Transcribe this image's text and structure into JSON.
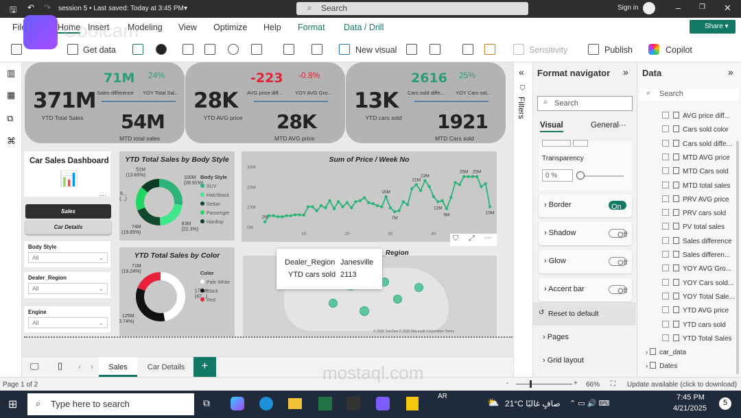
{
  "window": {
    "title": "session 5 • Last saved: Today at 3:45 PM",
    "search": "Search",
    "sign_in": "Sign in"
  },
  "menu": [
    "File",
    "Home",
    "Insert",
    "Modeling",
    "View",
    "Optimize",
    "Help",
    "Format",
    "Data / Drill"
  ],
  "share": "Share",
  "ribbon": {
    "get_data": "Get data",
    "new_visual": "New visual",
    "sensitivity": "Sensitivity",
    "publish": "Publish",
    "copilot": "Copilot"
  },
  "watermarks": {
    "coolcam": "Coolcam",
    "mostaql": "mostaql.com"
  },
  "kpis": [
    {
      "main": "371M",
      "main_label": "YTD Total Sales",
      "a": "71M",
      "a_label": "Sales difference",
      "b": "24%",
      "b_label": "YOY Total Sal...",
      "mtd": "54M",
      "mtd_label": "MTD total sales",
      "a_color": "#2a9d72"
    },
    {
      "main": "28K",
      "main_label": "YTD AVG price",
      "a": "-223",
      "a_label": "AVG price diff...",
      "b": "-0.8%",
      "b_label": "YOY AVG Gro...",
      "mtd": "28K",
      "mtd_label": "MTD AVG price",
      "a_color": "#e02238"
    },
    {
      "main": "13K",
      "main_label": "YTD cars sold",
      "a": "2616",
      "a_label": "Cars sold diffe...",
      "b": "25%",
      "b_label": "YOY Cars sol...",
      "mtd": "1921",
      "mtd_label": "MTD Cars sold",
      "a_color": "#2a9d72"
    }
  ],
  "left": {
    "title": "Car Sales Dashboard",
    "btn_sales": "Sales",
    "btn_details": "Car Details",
    "slicers": [
      {
        "label": "Body Style",
        "value": "All"
      },
      {
        "label": "Dealer_Region",
        "value": "All"
      },
      {
        "label": "Engine",
        "value": "All"
      }
    ]
  },
  "chart_data": [
    {
      "type": "pie",
      "title": "YTD Total Sales by Body Style",
      "legend_title": "Body Style",
      "legend": "right",
      "slices": [
        {
          "name": "SUV",
          "value": 100,
          "label": "100M",
          "pct": "(26.91%)",
          "color": "#2db37a"
        },
        {
          "name": "Hatchback",
          "value": 83,
          "label": "83M",
          "pct": "(22.3%)",
          "color": "#3ee88a"
        },
        {
          "name": "Sedan",
          "value": 74,
          "label": "74M",
          "pct": "(19.85%)",
          "color": "#11482e"
        },
        {
          "name": "Passenger",
          "value": 63,
          "label": "6...",
          "pct": "(...)",
          "color": "#1fd660"
        },
        {
          "name": "Hardtop",
          "value": 51,
          "label": "51M",
          "pct": "(13.65%)",
          "color": "#0d3a24"
        }
      ]
    },
    {
      "type": "line",
      "title": "Sum of Price / Week No",
      "ylim": [
        0,
        30
      ],
      "yticks": [
        "0M",
        "10M",
        "20M",
        "30M"
      ],
      "xticks": [
        10,
        20,
        30,
        40
      ],
      "unit": "M",
      "x_start": 1,
      "values": [
        2.5,
        5.5,
        5.5,
        5,
        5,
        5.5,
        5.5,
        6,
        6,
        5.8,
        10,
        10,
        8,
        10.5,
        9.5,
        13,
        9,
        12.5,
        10,
        12,
        9.5,
        12.5,
        13,
        14.5,
        12,
        11.5,
        10.5,
        10,
        15,
        9.5,
        7.5,
        8,
        12.5,
        11,
        19,
        21,
        18,
        23,
        20,
        15,
        12.5,
        13,
        9,
        14.5,
        22,
        21,
        25,
        25,
        25,
        25,
        20,
        21.5,
        10
      ],
      "point_labels": [
        {
          "week": 1,
          "text": "2M"
        },
        {
          "week": 29,
          "text": "15M"
        },
        {
          "week": 31,
          "text": "7M"
        },
        {
          "week": 36,
          "text": "21M"
        },
        {
          "week": 38,
          "text": "23M"
        },
        {
          "week": 41,
          "text": "12M"
        },
        {
          "week": 43,
          "text": "9M"
        },
        {
          "week": 47,
          "text": "25M"
        },
        {
          "week": 50,
          "text": "25M"
        },
        {
          "week": 53,
          "text": "10M"
        }
      ],
      "color": "#2db37a"
    },
    {
      "type": "pie",
      "title": "YTD Total Sales by Color",
      "legend_title": "Color",
      "legend": "right",
      "slices": [
        {
          "name": "Pale White",
          "value": 175,
          "label": "175M",
          "pct": "(47...)",
          "color": "#ffffff"
        },
        {
          "name": "Black",
          "value": 125,
          "label": "125M",
          "pct": "(33.74%)",
          "color": "#111111"
        },
        {
          "name": "Red",
          "value": 71,
          "label": "71M",
          "pct": "(19.24%)",
          "color": "#e8203a"
        }
      ]
    }
  ],
  "map": {
    "title": "ler_Region",
    "tooltip": {
      "k1": "Dealer_Region",
      "v1": "Janesville",
      "k2": "YTD cars sold",
      "v2": "2113"
    },
    "attribution": "© 2025 TomTom © 2025 Microsoft Corporation  Terms"
  },
  "filters_label": "Filters",
  "format": {
    "title": "Format navigator",
    "search": "Search",
    "tab_visual": "Visual",
    "tab_general": "General",
    "transparency": "Transparency",
    "transparency_value": "0 %",
    "transparency_pct": 0,
    "cards": [
      {
        "label": "Border",
        "state": "On",
        "on": true
      },
      {
        "label": "Shadow",
        "state": "Off",
        "on": false
      },
      {
        "label": "Glow",
        "state": "Off",
        "on": false
      },
      {
        "label": "Accent bar",
        "state": "Off",
        "on": false
      }
    ],
    "reset": "Reset to default",
    "pages": "Pages",
    "grid": "Grid layout"
  },
  "data": {
    "title": "Data",
    "search": "Search",
    "fields": [
      "AVG price diff...",
      "Cars sold color",
      "Cars sold diffe...",
      "MTD AVG price",
      "MTD Cars sold",
      "MTD total sales",
      "PRV AVG price",
      "PRV cars sold",
      "PV total sales",
      "Sales difference",
      "Sales differen...",
      "YOY AVG Gro...",
      "YOY Cars sold...",
      "YOY Total Sale...",
      "YTD AVG price",
      "YTD cars sold",
      "YTD Total Sales"
    ],
    "tables": [
      "car_data",
      "Dates"
    ]
  },
  "tabs": [
    "Sales",
    "Car Details"
  ],
  "status": {
    "page": "Page 1 of 2",
    "zoom": "66%",
    "update": "Update available (click to download)"
  },
  "taskbar": {
    "search": "Type here to search",
    "lang": "AR",
    "weather": "21°C  صافٍ غالبًا",
    "time": "7:45 PM",
    "date": "4/21/2025",
    "notif": "5"
  }
}
